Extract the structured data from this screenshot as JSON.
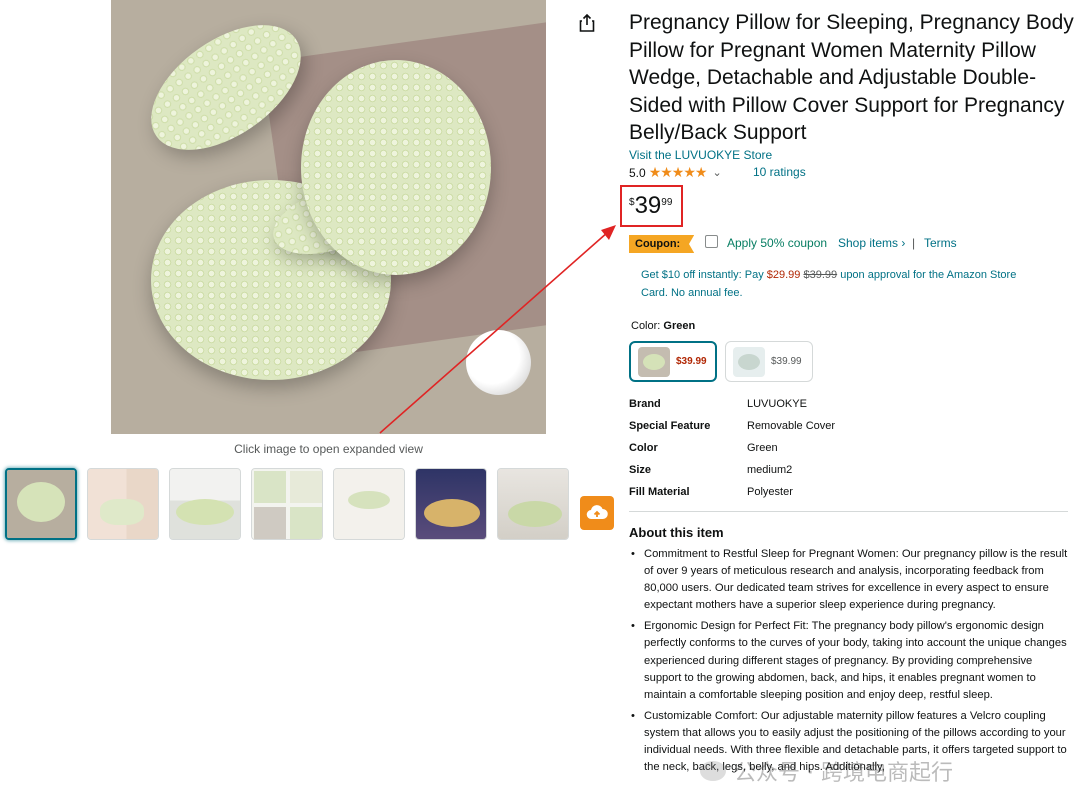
{
  "product": {
    "title": "Pregnancy Pillow for Sleeping, Pregnancy Body Pillow for Pregnant Women Maternity Pillow Wedge, Detachable and Adjustable Double-Sided with Pillow Cover Support for Pregnancy Belly/Back Support",
    "store_link": "Visit the LUVUOKYE Store",
    "rating": "5.0",
    "stars": "★★★★★",
    "rating_chevron": "⌄",
    "ratings_count": "10 ratings",
    "price": {
      "symbol": "$",
      "whole": "39",
      "fraction": "99"
    }
  },
  "gallery": {
    "caption": "Click image to open expanded view",
    "thumbnails": [
      "thumb-1",
      "thumb-2",
      "thumb-3",
      "thumb-4",
      "thumb-5",
      "thumb-6",
      "thumb-7"
    ],
    "active_index": 0
  },
  "coupon": {
    "badge": "Coupon:",
    "apply_text": "Apply 50% coupon",
    "shop_items": "Shop items ›",
    "separator": "|",
    "terms": "Terms"
  },
  "promo": {
    "prefix": "Get $10 off instantly: Pay ",
    "new_price": "$29.99",
    "old_price": "$39.99",
    "suffix": " upon approval for the Amazon Store Card. No annual fee."
  },
  "color": {
    "label": "Color:",
    "value": "Green",
    "options": [
      {
        "price": "$39.99",
        "selected": true
      },
      {
        "price": "$39.99",
        "selected": false
      }
    ]
  },
  "specs": [
    {
      "key": "Brand",
      "value": "LUVUOKYE"
    },
    {
      "key": "Special Feature",
      "value": "Removable Cover"
    },
    {
      "key": "Color",
      "value": "Green"
    },
    {
      "key": "Size",
      "value": "medium2"
    },
    {
      "key": "Fill Material",
      "value": "Polyester"
    }
  ],
  "about": {
    "title": "About this item",
    "bullets": [
      "Commitment to Restful Sleep for Pregnant Women: Our pregnancy pillow is the result of over 9 years of meticulous research and analysis, incorporating feedback from 80,000 users. Our dedicated team strives for excellence in every aspect to ensure expectant mothers have a superior sleep experience during pregnancy.",
      "Ergonomic Design for Perfect Fit: The pregnancy body pillow's ergonomic design perfectly conforms to the curves of your body, taking into account the unique changes experienced during different stages of pregnancy. By providing comprehensive support to the growing abdomen, back, and hips, it enables pregnant women to maintain a comfortable sleeping position and enjoy deep, restful sleep.",
      "Customizable Comfort: Our adjustable maternity pillow features a Velcro coupling system that allows you to easily adjust the positioning of the pillows according to your individual needs. With three flexible and detachable parts, it offers targeted support to the neck, back, legs, belly, and hips. Additionally,"
    ]
  },
  "watermark": {
    "text": "公众号 · 跨境电商起行"
  },
  "icons": {
    "share": "share-icon",
    "upload": "cloud-upload-icon"
  },
  "colors": {
    "link": "#007185",
    "star": "#f08c1a",
    "price_red": "#b12704",
    "highlight": "#e02424",
    "coupon": "#f5a623"
  }
}
